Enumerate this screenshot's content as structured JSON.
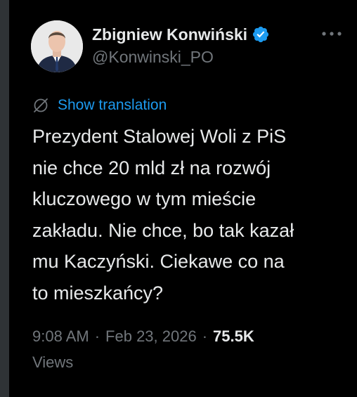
{
  "colors": {
    "background": "#000000",
    "text_primary": "#e7e9ea",
    "text_secondary": "#71767b",
    "link": "#1d9bf0",
    "verified_badge": "#1d9bf0"
  },
  "author": {
    "display_name": "Zbigniew Konwiński",
    "handle": "@Konwinski_PO",
    "verified": true,
    "avatar_icon": "profile-photo"
  },
  "actions": {
    "more_icon": "ellipsis-icon"
  },
  "translation": {
    "icon": "globe-icon",
    "label": "Show translation"
  },
  "tweet": {
    "text": "Prezydent Stalowej Woli z PiS\nnie chce 20 mld zł na rozwój\nkluczowego w tym mieście\nzakładu. Nie chce, bo tak kazał\nmu Kaczyński. Ciekawe co na\nto mieszkańcy?"
  },
  "meta": {
    "time": "9:08 AM",
    "separator": "·",
    "date": "Feb 23, 2026",
    "views_count": "75.5K",
    "views_label": "Views"
  }
}
